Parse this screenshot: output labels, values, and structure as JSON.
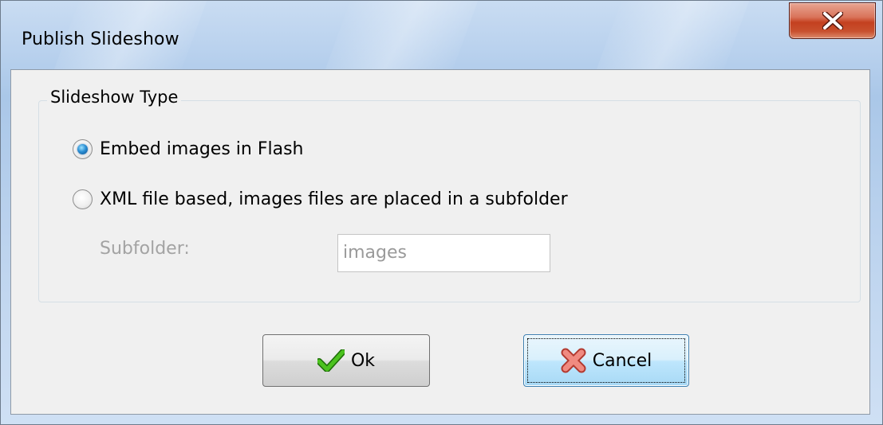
{
  "window": {
    "title": "Publish Slideshow",
    "close_icon": "close-icon"
  },
  "group": {
    "title": "Slideshow Type",
    "options": [
      {
        "label": "Embed images in Flash",
        "checked": true
      },
      {
        "label": "XML file based, images files are placed in a subfolder",
        "checked": false
      }
    ],
    "subfolder": {
      "label": "Subfolder:",
      "value": "images",
      "enabled": false
    }
  },
  "buttons": {
    "ok": {
      "label": "Ok",
      "icon": "checkmark-icon"
    },
    "cancel": {
      "label": "Cancel",
      "icon": "cross-icon",
      "focused": true
    }
  },
  "colors": {
    "close_button": "#c4401f",
    "ok_icon": "#3aa517",
    "cancel_icon": "#e0685c",
    "radio_checked": "#2b8fd4"
  }
}
